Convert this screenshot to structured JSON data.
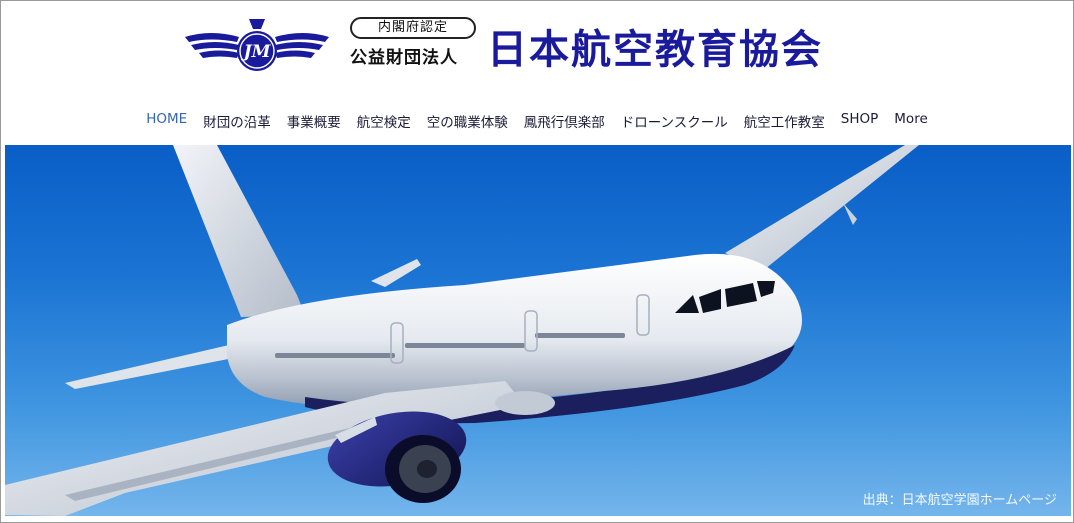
{
  "header": {
    "badge": "内閣府認定",
    "foundation_type": "公益財団法人",
    "org_name": "日本航空教育協会",
    "emblem_text": "JM"
  },
  "nav": {
    "items": [
      {
        "label": "HOME",
        "active": true
      },
      {
        "label": "財団の沿革"
      },
      {
        "label": "事業概要"
      },
      {
        "label": "航空検定"
      },
      {
        "label": "空の職業体験"
      },
      {
        "label": "鳳飛行倶楽部"
      },
      {
        "label": "ドローンスクール"
      },
      {
        "label": "航空工作教室"
      },
      {
        "label": "SHOP"
      },
      {
        "label": "More"
      }
    ]
  },
  "hero": {
    "credit": "出典：日本航空学園ホームページ"
  },
  "colors": {
    "brand": "#1a1a9c",
    "nav_active": "#3566b4",
    "sky": "#1b74d3"
  }
}
